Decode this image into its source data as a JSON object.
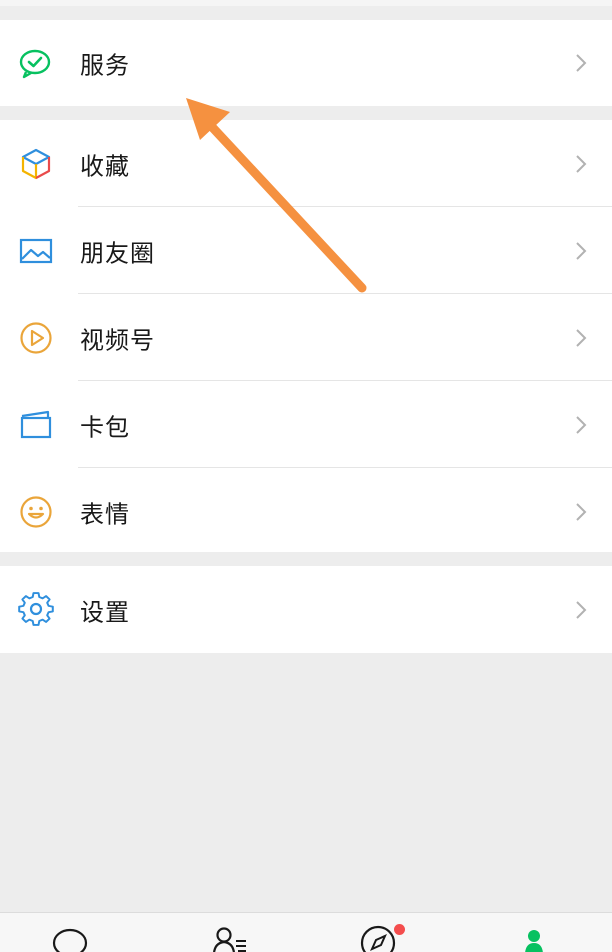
{
  "menu": {
    "services": {
      "label": "服务",
      "icon": "services-icon"
    },
    "items": [
      {
        "label": "收藏",
        "icon": "favorites-cube-icon"
      },
      {
        "label": "朋友圈",
        "icon": "moments-picture-icon"
      },
      {
        "label": "视频号",
        "icon": "channels-play-icon"
      },
      {
        "label": "卡包",
        "icon": "card-wallet-icon"
      },
      {
        "label": "表情",
        "icon": "sticker-smiley-icon"
      }
    ],
    "settings": {
      "label": "设置",
      "icon": "settings-gear-icon"
    }
  },
  "tabbar": {
    "tabs": [
      {
        "icon": "chats-bubble-icon",
        "active": false
      },
      {
        "icon": "contacts-icon",
        "active": false
      },
      {
        "icon": "discover-compass-icon",
        "active": false,
        "badge": true
      },
      {
        "icon": "me-person-icon",
        "active": true
      }
    ]
  },
  "colors": {
    "brand_green": "#07c160",
    "badge_red": "#f44d4d",
    "annotation_arrow": "#f59140",
    "background": "#ededed"
  }
}
